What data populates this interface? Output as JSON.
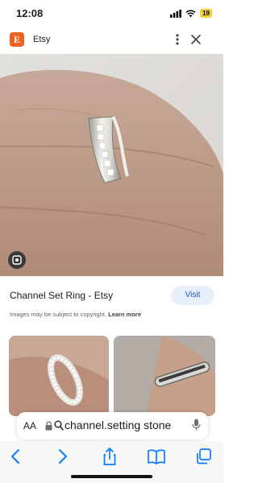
{
  "status_bar": {
    "time": "12:08",
    "battery": "19"
  },
  "header": {
    "site_name": "Etsy",
    "logo_letter": "E",
    "brand_color": "#ea6320"
  },
  "result": {
    "title": "Channel Set Ring - Etsy",
    "visit_label": "Visit",
    "copyright_text": "Images may be subject to copyright.",
    "learn_more": "Learn more"
  },
  "address_bar": {
    "aa_label": "AA",
    "url_text": "channel.setting stone"
  },
  "icons": [
    "signal-icon",
    "wifi-icon",
    "more-icon",
    "close-icon",
    "lens-icon",
    "lock-icon",
    "search-icon",
    "mic-icon",
    "back-icon",
    "forward-icon",
    "share-icon",
    "bookmarks-icon",
    "tabs-icon"
  ],
  "colors": {
    "accent": "#0a7aff",
    "visit_bg": "#e8effb",
    "visit_text": "#1a56c4"
  }
}
